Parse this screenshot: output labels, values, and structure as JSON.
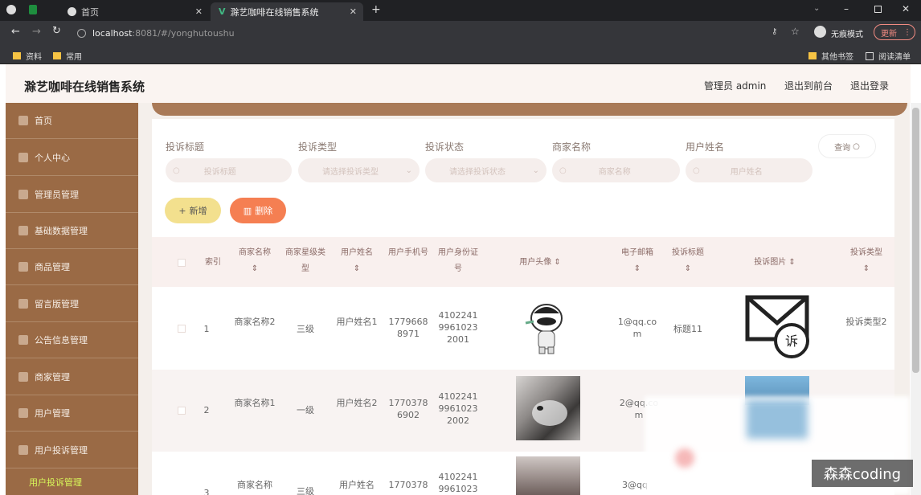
{
  "browser": {
    "tabs": [
      {
        "title": "首页"
      },
      {
        "title": "滁艺咖啡在线销售系统"
      }
    ],
    "url_host": "localhost",
    "url_rest": ":8081/#/yonghutoushu",
    "incognito_label": "无痕模式",
    "update_label": "更新",
    "bookmarks": [
      "资料",
      "常用"
    ],
    "other_bookmarks": "其他书签",
    "reading_list": "阅读清单"
  },
  "header": {
    "title": "滁艺咖啡在线销售系统",
    "admin": "管理员 admin",
    "front": "退出到前台",
    "logout": "退出登录"
  },
  "sidebar": {
    "items": [
      "首页",
      "个人中心",
      "管理员管理",
      "基础数据管理",
      "商品管理",
      "留言版管理",
      "公告信息管理",
      "商家管理",
      "用户管理",
      "用户投诉管理"
    ],
    "sub_item": "用户投诉管理"
  },
  "filters": {
    "labels": [
      "投诉标题",
      "投诉类型",
      "投诉状态",
      "商家名称",
      "用户姓名"
    ],
    "placeholders": [
      "投诉标题",
      "请选择投诉类型",
      "请选择投诉状态",
      "商家名称",
      "用户姓名"
    ],
    "query": "查询"
  },
  "actions": {
    "add": "新增",
    "delete": "删除"
  },
  "table": {
    "headers": {
      "index": "索引",
      "shop": "商家名称",
      "level": "商家星级类型",
      "user": "用户姓名",
      "phone": "用户手机号",
      "idcard": "用户身份证号",
      "avatar": "用户头像",
      "email": "电子邮箱",
      "title": "投诉标题",
      "image": "投诉图片",
      "type": "投诉类型"
    },
    "rows": [
      {
        "index": "1",
        "shop": "商家名称2",
        "level": "三级",
        "user": "用户姓名1",
        "phone": "17796688971",
        "idcard": "410224199610232001",
        "email": "1@qq.com",
        "title": "标题11",
        "type": "投诉类型2"
      },
      {
        "index": "2",
        "shop": "商家名称1",
        "level": "一级",
        "user": "用户姓名2",
        "phone": "17703786902",
        "idcard": "410224199610232002",
        "email": "2@qq.com",
        "title": "",
        "type": ""
      },
      {
        "index": "3",
        "shop": "商家名称",
        "level": "三级",
        "user": "用户姓名",
        "phone": "1770378",
        "idcard": "41022419961023",
        "email": "3@qq",
        "title": "",
        "type": ""
      }
    ]
  },
  "watermark": "森森coding",
  "colors": {
    "sidebar": "#9a6a45",
    "accent": "#a97a58",
    "add": "#f3e08e",
    "delete": "#f57f52"
  }
}
